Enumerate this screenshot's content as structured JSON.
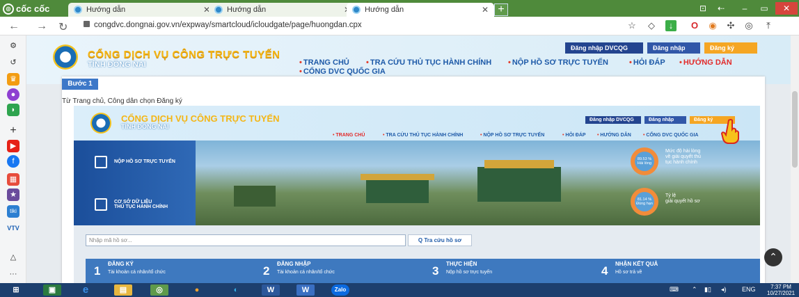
{
  "browser": {
    "brand": "cốc cốc",
    "tabs": [
      {
        "label": "Hướng dẫn",
        "active": false
      },
      {
        "label": "Hướng dẫn",
        "active": false
      },
      {
        "label": "Hướng dẫn",
        "active": true
      }
    ],
    "url": "congdvc.dongnai.gov.vn/expway/smartcloud/icloudgate/page/huongdan.cpx"
  },
  "site": {
    "title_line1": "CỔNG DỊCH VỤ CÔNG TRỰC TUYẾN",
    "title_line2": "TỈNH ĐỒNG NAI",
    "auth": {
      "dvcqg": "Đăng nhập DVCQG",
      "login": "Đăng nhập",
      "register": "Đăng ký"
    },
    "menu": [
      {
        "label": "TRANG CHỦ"
      },
      {
        "label": "TRA CỨU THỦ TỤC HÀNH CHÍNH"
      },
      {
        "label": "NỘP HỒ SƠ TRỰC TUYẾN"
      },
      {
        "label": "HỎI ĐÁP"
      },
      {
        "label": "HƯỚNG DẪN"
      },
      {
        "label": "CỔNG DVC QUỐC GIA"
      }
    ]
  },
  "guide": {
    "step_badge": "Bước 1",
    "lead": "Từ Trang chủ, Công dân chọn Đăng ký",
    "shot": {
      "title_line1": "CỔNG DỊCH VỤ CÔNG TRỰC TUYẾN",
      "title_line2": "TỈNH ĐỒNG NAI",
      "auth": {
        "dvcqg": "Đăng nhập DVCQG",
        "login": "Đăng nhập",
        "register": "Đăng ký"
      },
      "menu": [
        "TRANG CHỦ",
        "TRA CỨU THỦ TỤC HÀNH CHÍNH",
        "NỘP HỒ SƠ TRỰC TUYẾN",
        "HỎI ĐÁP",
        "HƯỚNG DẪN",
        "CỔNG DVC QUỐC GIA"
      ],
      "panels": [
        "NỘP HỒ SƠ TRỰC TUYẾN",
        "CƠ SỞ DỮ LIỆU",
        "THỦ TỤC HÀNH CHÍNH"
      ],
      "stats": [
        {
          "value": "89.53 %",
          "sub": "Hài lòng",
          "label1": "Mức độ hài lòng",
          "label2": "về giải quyết thủ",
          "label3": "tục hành chính"
        },
        {
          "value": "81.14 %",
          "sub": "Đúng hạn",
          "label1": "Tỷ lệ",
          "label2": "giải quyết hồ sơ"
        }
      ],
      "search_placeholder": "Nhập mã hồ sơ...",
      "search_button": "Tra cứu hồ sơ",
      "steps": [
        {
          "num": "1",
          "title": "ĐĂNG KÝ",
          "sub": "Tài khoản cá nhân/tổ chức"
        },
        {
          "num": "2",
          "title": "ĐĂNG NHẬP",
          "sub": "Tài khoản cá nhân/tổ chức"
        },
        {
          "num": "3",
          "title": "THỰC HIỆN",
          "sub": "Nộp hồ sơ trực tuyến"
        },
        {
          "num": "4",
          "title": "NHẬN KẾT QUẢ",
          "sub": "Hồ sơ trả về"
        }
      ]
    }
  },
  "taskbar": {
    "lang": "ENG",
    "time": "7:37 PM",
    "date": "10/27/2021",
    "zalo": "Zalo"
  },
  "colors": {
    "accent_blue": "#23448f",
    "accent_orange": "#f5a623",
    "menu_red": "#e22b2b",
    "cococ_green": "#4f8a3b"
  }
}
